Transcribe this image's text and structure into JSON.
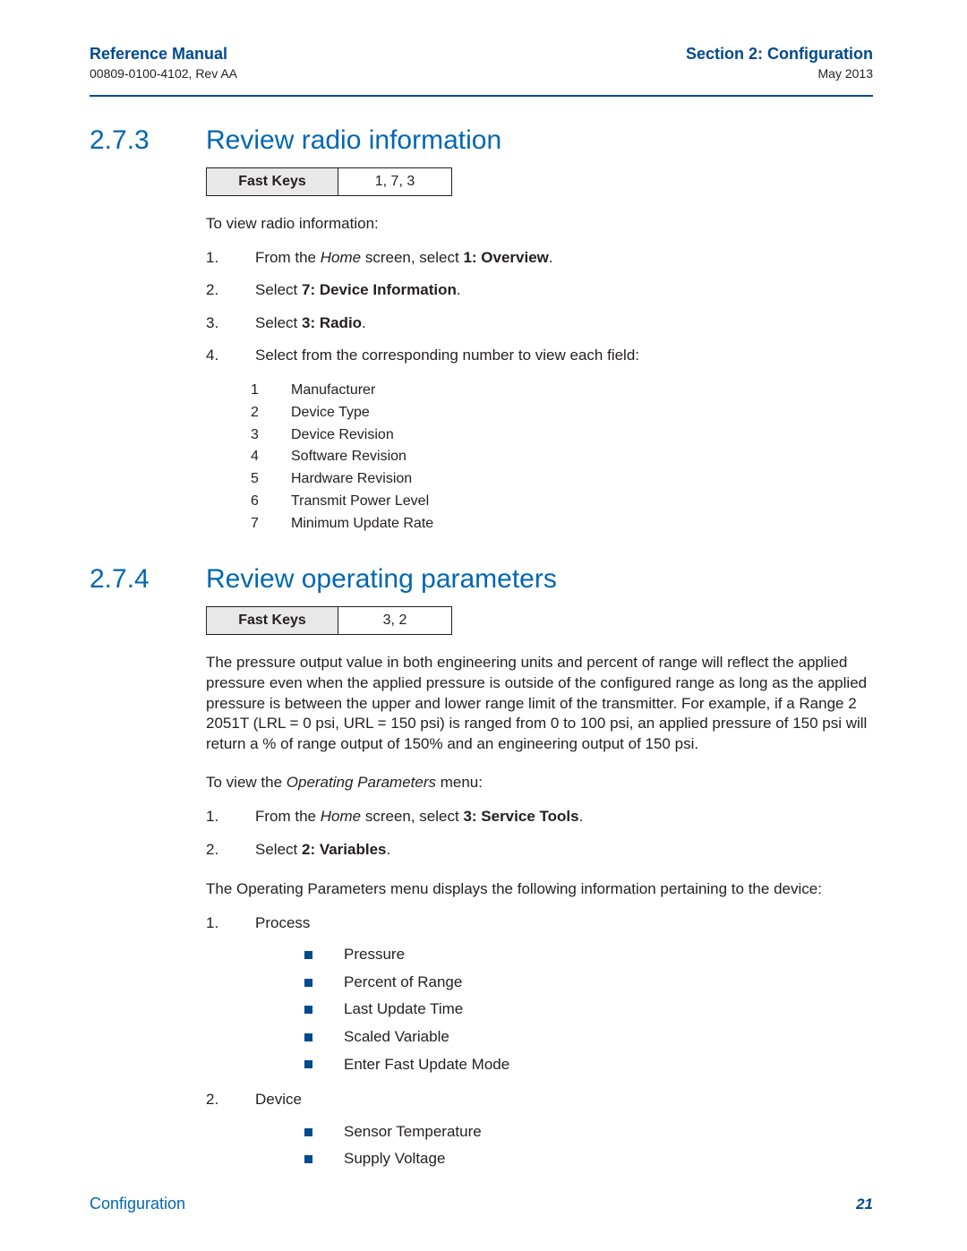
{
  "header": {
    "left_title": "Reference Manual",
    "left_sub": "00809-0100-4102, Rev AA",
    "right_title": "Section 2: Configuration",
    "right_sub": "May 2013"
  },
  "s273": {
    "num": "2.7.3",
    "title": "Review radio information",
    "fast_keys_label": "Fast Keys",
    "fast_keys_value": "1, 7, 3",
    "intro": "To view radio information:",
    "steps": [
      {
        "n": "1.",
        "pre": "From the ",
        "ital": "Home",
        "mid": " screen, select ",
        "bold": "1: Overview",
        "post": "."
      },
      {
        "n": "2.",
        "pre": "Select ",
        "bold": "7: Device Information",
        "post": "."
      },
      {
        "n": "3.",
        "pre": "Select ",
        "bold": "3: Radio",
        "post": "."
      },
      {
        "n": "4.",
        "pre": "Select from the corresponding number to view each field:"
      }
    ],
    "fields": [
      {
        "n": "1",
        "label": "Manufacturer"
      },
      {
        "n": "2",
        "label": "Device Type"
      },
      {
        "n": "3",
        "label": "Device Revision"
      },
      {
        "n": "4",
        "label": "Software Revision"
      },
      {
        "n": "5",
        "label": "Hardware Revision"
      },
      {
        "n": "6",
        "label": "Transmit Power Level"
      },
      {
        "n": "7",
        "label": "Minimum Update Rate"
      }
    ]
  },
  "s274": {
    "num": "2.7.4",
    "title": "Review operating parameters",
    "fast_keys_label": "Fast Keys",
    "fast_keys_value": "3, 2",
    "para1": "The pressure output value in both engineering units and percent of range will reflect the applied pressure even when the applied pressure is outside of the configured range as long as the applied pressure is between the upper and lower range limit of the transmitter. For example, if a Range 2 2051T (LRL = 0 psi, URL = 150 psi) is ranged from 0 to 100 psi, an applied pressure of 150 psi will return a % of range output of 150% and an engineering output of 150 psi.",
    "para2_pre": "To view the ",
    "para2_ital": "Operating Parameters",
    "para2_post": " menu:",
    "steps": [
      {
        "n": "1.",
        "pre": "From the ",
        "ital": "Home",
        "mid": " screen, select ",
        "bold": "3: Service Tools",
        "post": "."
      },
      {
        "n": "2.",
        "pre": "Select ",
        "bold": "2: Variables",
        "post": "."
      }
    ],
    "para3": "The Operating Parameters menu displays the following information pertaining to the device:",
    "groups": [
      {
        "n": "1.",
        "label": "Process",
        "items": [
          "Pressure",
          "Percent of Range",
          "Last Update Time",
          "Scaled Variable",
          "Enter Fast Update Mode"
        ]
      },
      {
        "n": "2.",
        "label": "Device",
        "items": [
          "Sensor Temperature",
          "Supply Voltage"
        ]
      }
    ]
  },
  "footer": {
    "left": "Configuration",
    "right": "21"
  }
}
